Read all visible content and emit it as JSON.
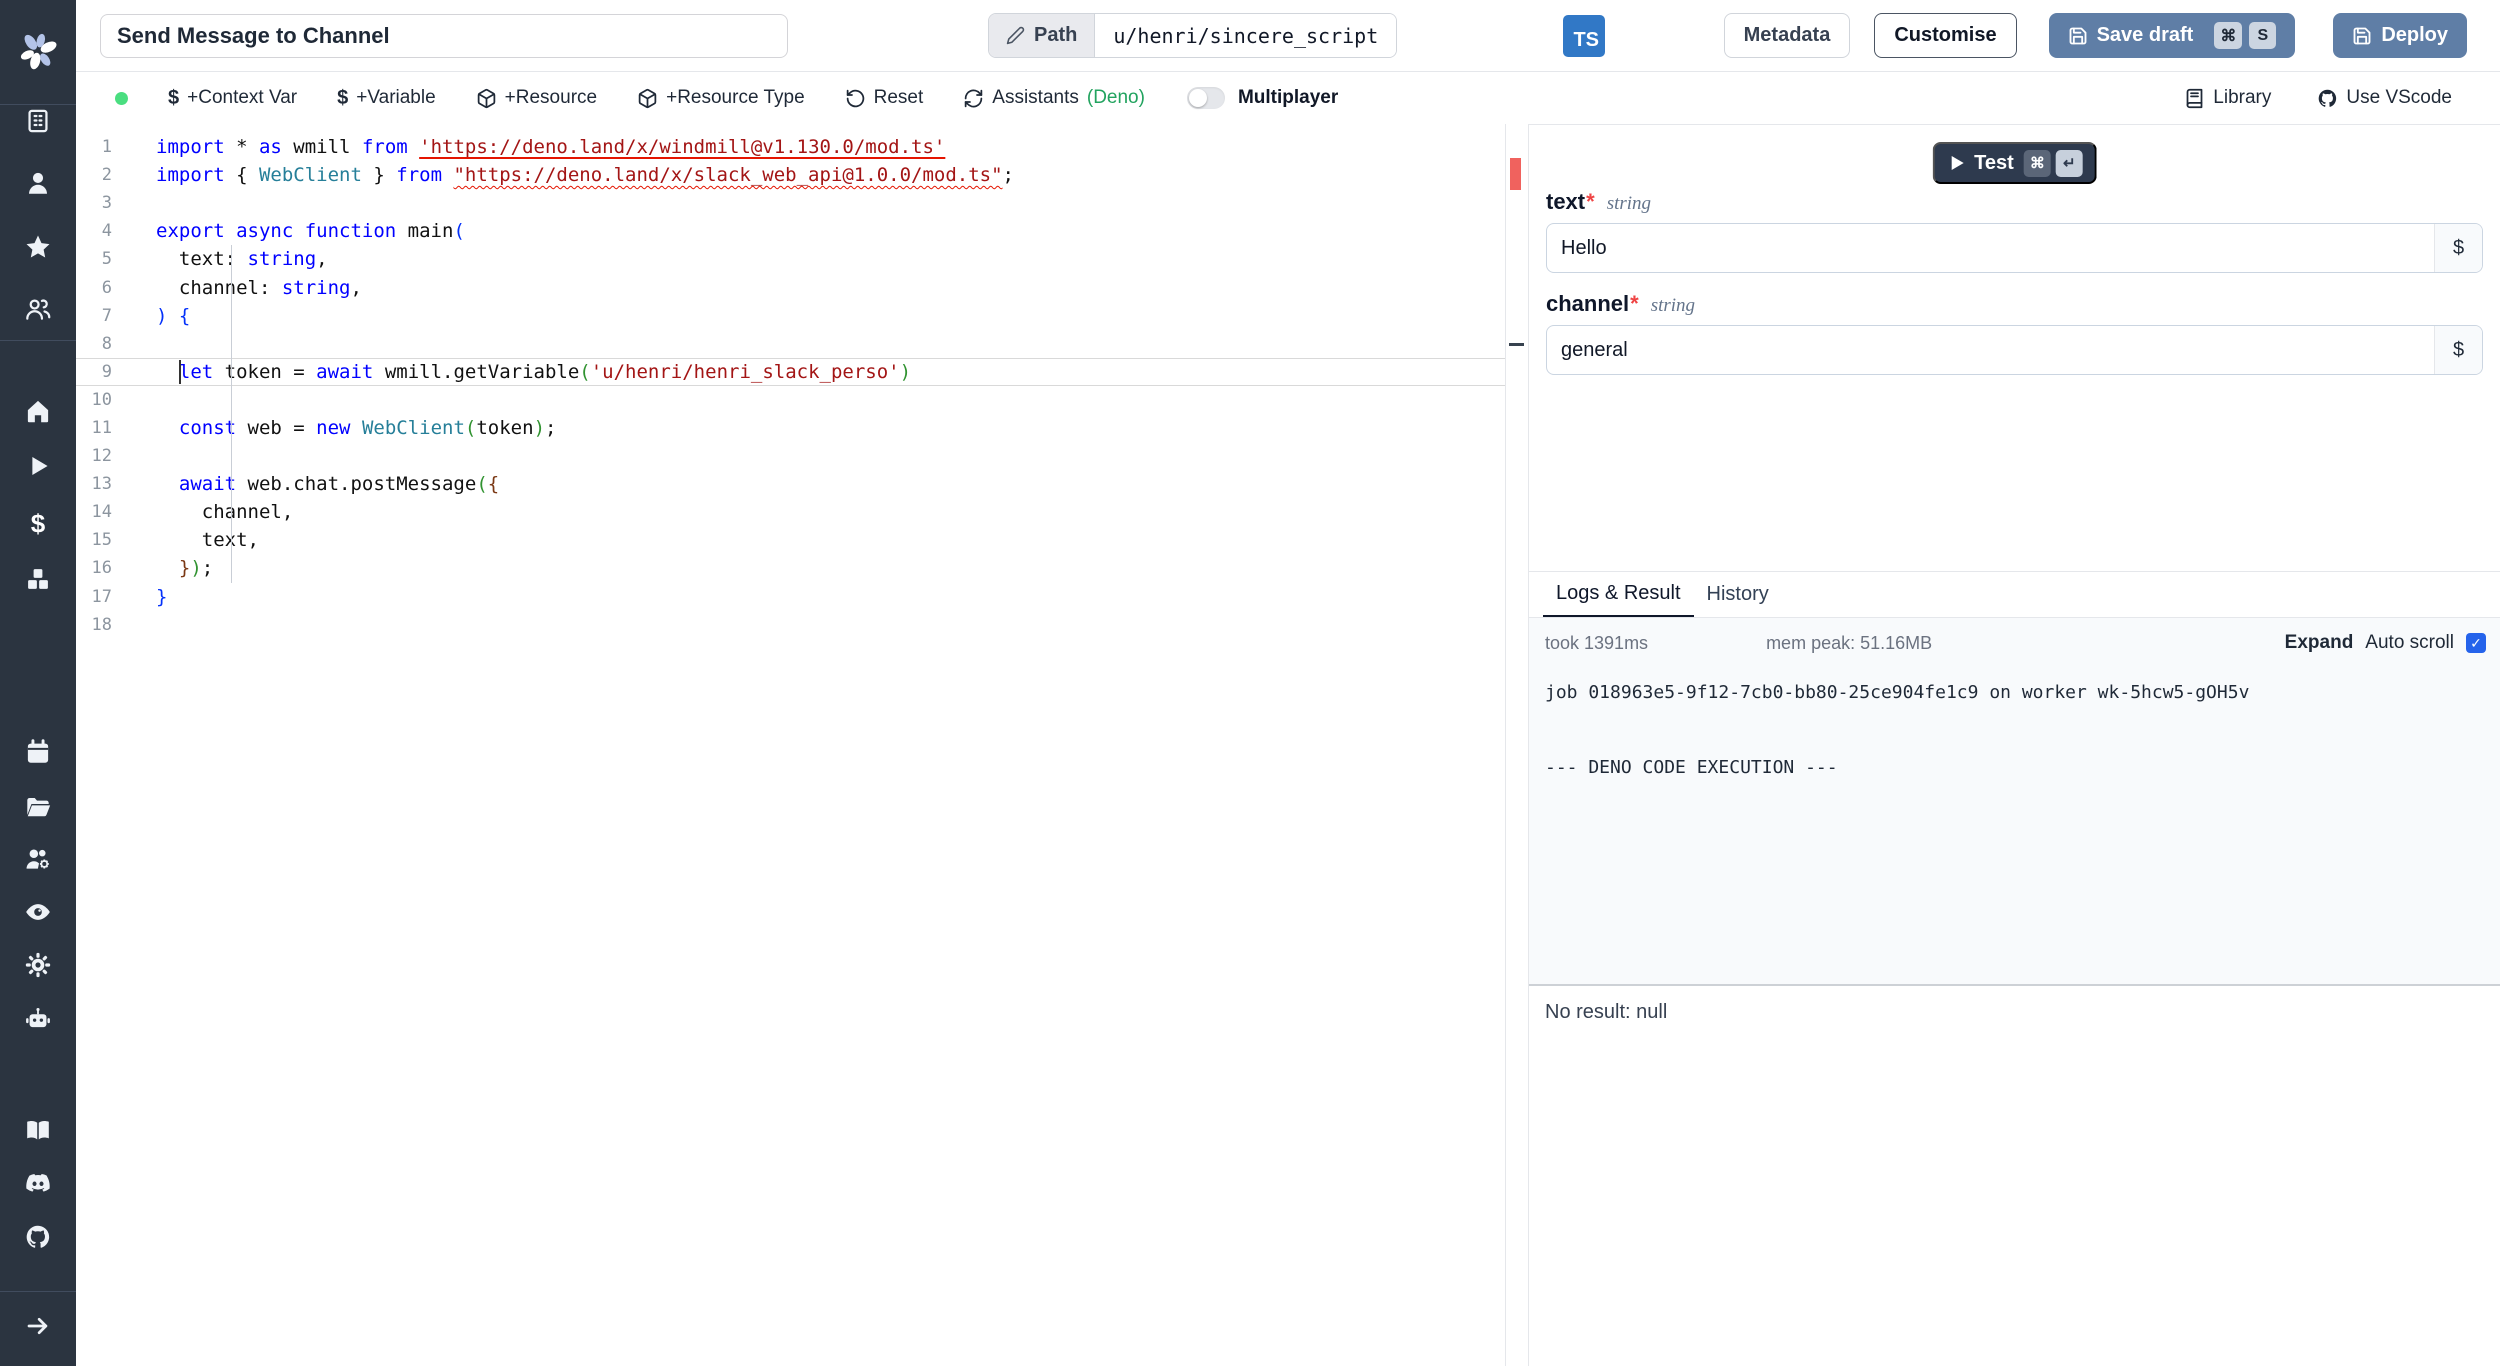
{
  "topbar": {
    "title": "Send Message to Channel",
    "path_label": "Path",
    "path_value": "u/henri/sincere_script",
    "lang_badge": "TS",
    "metadata": "Metadata",
    "customise": "Customise",
    "save_draft": "Save draft",
    "save_keys": [
      "⌘",
      "S"
    ],
    "deploy": "Deploy"
  },
  "toolbar": {
    "context_var": "+Context Var",
    "variable": "+Variable",
    "resource": "+Resource",
    "resource_type": "+Resource Type",
    "reset": "Reset",
    "assistants": "Assistants",
    "assistants_lang": "(Deno)",
    "multiplayer": "Multiplayer",
    "library": "Library",
    "use_vscode": "Use VScode"
  },
  "editor": {
    "current_line": 9,
    "lines": [
      {
        "n": 1,
        "segs": [
          {
            "c": "k",
            "t": "import "
          },
          {
            "c": "d",
            "t": "* "
          },
          {
            "c": "k",
            "t": "as "
          },
          {
            "c": "d",
            "t": "wmill "
          },
          {
            "c": "k",
            "t": "from "
          },
          {
            "c": "s",
            "u": "solid",
            "t": "'https://deno.land/x/windmill@v1.130.0/mod.ts'"
          }
        ]
      },
      {
        "n": 2,
        "segs": [
          {
            "c": "k",
            "t": "import "
          },
          {
            "c": "d",
            "t": "{ "
          },
          {
            "c": "t",
            "t": "WebClient"
          },
          {
            "c": "d",
            "t": " } "
          },
          {
            "c": "k",
            "t": "from "
          },
          {
            "c": "s",
            "u": "wavy",
            "t": "\"https://deno.land/x/slack_web_api@1.0.0/mod.ts\""
          },
          {
            "c": "d",
            "t": ";"
          }
        ]
      },
      {
        "n": 3,
        "segs": []
      },
      {
        "n": 4,
        "segs": [
          {
            "c": "k",
            "t": "export "
          },
          {
            "c": "k",
            "t": "async "
          },
          {
            "c": "k",
            "t": "function "
          },
          {
            "c": "d",
            "t": "main"
          },
          {
            "c": "b1",
            "t": "("
          }
        ]
      },
      {
        "n": 5,
        "segs": [
          {
            "c": "d",
            "t": "  text: "
          },
          {
            "c": "k",
            "t": "string"
          },
          {
            "c": "d",
            "t": ","
          }
        ]
      },
      {
        "n": 6,
        "segs": [
          {
            "c": "d",
            "t": "  channel: "
          },
          {
            "c": "k",
            "t": "string"
          },
          {
            "c": "d",
            "t": ","
          }
        ]
      },
      {
        "n": 7,
        "segs": [
          {
            "c": "b1",
            "t": ")"
          },
          {
            "c": "d",
            "t": " "
          },
          {
            "c": "b1",
            "t": "{"
          }
        ]
      },
      {
        "n": 8,
        "segs": []
      },
      {
        "n": 9,
        "segs": [
          {
            "c": "d",
            "t": "  "
          },
          {
            "c": "k",
            "t": "let"
          },
          {
            "c": "d",
            "t": " token = "
          },
          {
            "c": "k",
            "t": "await"
          },
          {
            "c": "d",
            "t": " wmill.getVariable"
          },
          {
            "c": "b2",
            "t": "("
          },
          {
            "c": "s",
            "t": "'u/henri/henri_slack_perso'"
          },
          {
            "c": "b2",
            "t": ")"
          }
        ]
      },
      {
        "n": 10,
        "segs": []
      },
      {
        "n": 11,
        "segs": [
          {
            "c": "d",
            "t": "  "
          },
          {
            "c": "k",
            "t": "const"
          },
          {
            "c": "d",
            "t": " web = "
          },
          {
            "c": "k",
            "t": "new"
          },
          {
            "c": "d",
            "t": " "
          },
          {
            "c": "t",
            "t": "WebClient"
          },
          {
            "c": "b2",
            "t": "("
          },
          {
            "c": "d",
            "t": "token"
          },
          {
            "c": "b2",
            "t": ")"
          },
          {
            "c": "d",
            "t": ";"
          }
        ]
      },
      {
        "n": 12,
        "segs": []
      },
      {
        "n": 13,
        "segs": [
          {
            "c": "d",
            "t": "  "
          },
          {
            "c": "k",
            "t": "await"
          },
          {
            "c": "d",
            "t": " web.chat.postMessage"
          },
          {
            "c": "b2",
            "t": "("
          },
          {
            "c": "b3",
            "t": "{"
          }
        ]
      },
      {
        "n": 14,
        "segs": [
          {
            "c": "d",
            "t": "    channel,"
          }
        ]
      },
      {
        "n": 15,
        "segs": [
          {
            "c": "d",
            "t": "    text,"
          }
        ]
      },
      {
        "n": 16,
        "segs": [
          {
            "c": "d",
            "t": "  "
          },
          {
            "c": "b3",
            "t": "}"
          },
          {
            "c": "b2",
            "t": ")"
          },
          {
            "c": "d",
            "t": ";"
          }
        ]
      },
      {
        "n": 17,
        "segs": [
          {
            "c": "b1",
            "t": "}"
          }
        ]
      },
      {
        "n": 18,
        "segs": []
      }
    ]
  },
  "runner": {
    "test": "Test",
    "test_keys": [
      "⌘",
      "↵"
    ],
    "dollar": "$",
    "fields": [
      {
        "label": "text",
        "required": true,
        "type": "string",
        "value": "Hello"
      },
      {
        "label": "channel",
        "required": true,
        "type": "string",
        "value": "general"
      }
    ]
  },
  "logs": {
    "tabs": [
      "Logs & Result",
      "History"
    ],
    "active_tab": 0,
    "took": "took 1391ms",
    "mem": "mem peak: 51.16MB",
    "expand": "Expand",
    "autoscroll": "Auto scroll",
    "autoscroll_checked": true,
    "check_glyph": "✓",
    "lines": [
      "job 018963e5-9f12-7cb0-bb80-25ce904fe1c9 on worker wk-5hcw5-gOH5v",
      "",
      "",
      "--- DENO CODE EXECUTION ---"
    ],
    "no_result": "No result: null"
  },
  "sidebar": {
    "icons": [
      "building",
      "user",
      "star",
      "users",
      "home",
      "play",
      "dollar",
      "boxes",
      "calendar",
      "folder",
      "users-cog",
      "eye",
      "gear",
      "robot",
      "book",
      "discord",
      "github",
      "arrow-right"
    ]
  },
  "colors": {
    "sidebar_bg": "#2b3440",
    "primary_button": "#5f7ea6",
    "ts_blue": "#3178c6",
    "checkbox_blue": "#2563eb",
    "green_dot": "#4ade80",
    "deno_green": "#22a35f",
    "error_red": "#e51400"
  }
}
